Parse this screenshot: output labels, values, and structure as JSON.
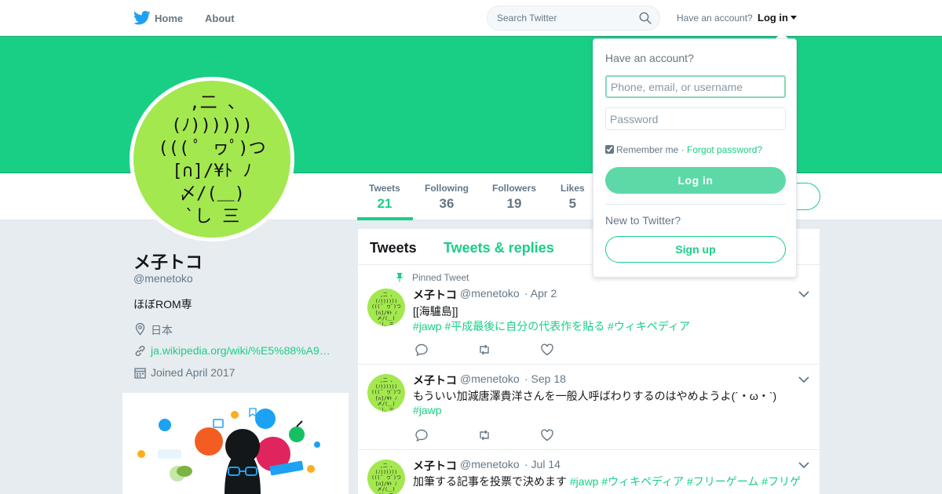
{
  "nav": {
    "home_label": "Home",
    "about_label": "About",
    "search_placeholder": "Search Twitter",
    "have_account": "Have an account?",
    "login_label": "Log in"
  },
  "profile": {
    "avatar_art": " ,二 、\n(ﾉ))))))\n((( ﾟ ヮﾟ)つ\n[∩]/¥ﾄ ﾉ\n〆/(＿)\n`し 三",
    "name": "メ子トコ",
    "handle": "@menetoko",
    "bio": "ほぼROM専",
    "location": "日本",
    "url": "ja.wikipedia.org/wiki/%E5%88%A9…",
    "joined": "Joined April 2017"
  },
  "stats": [
    {
      "label": "Tweets",
      "value": "21",
      "active": true
    },
    {
      "label": "Following",
      "value": "36",
      "active": false
    },
    {
      "label": "Followers",
      "value": "19",
      "active": false
    },
    {
      "label": "Likes",
      "value": "5",
      "active": false
    }
  ],
  "timeline": {
    "tabs": [
      {
        "label": "Tweets",
        "active": true
      },
      {
        "label": "Tweets & replies",
        "active": false
      }
    ],
    "pinned_label": "Pinned Tweet",
    "tweets": [
      {
        "name": "メ子トコ",
        "handle": "@menetoko",
        "date": "· Apr 2",
        "text": "[[海驢島]]",
        "tags": "#jawp #平成最後に自分の代表作を貼る #ウィキペディア"
      },
      {
        "name": "メ子トコ",
        "handle": "@menetoko",
        "date": "· Sep 18",
        "text": "もういい加減唐澤貴洋さんを一般人呼ばわりするのはやめようよ(´・ω・`)",
        "tags": "#jawp"
      },
      {
        "name": "メ子トコ",
        "handle": "@menetoko",
        "date": "· Jul 14",
        "text": "加筆する記事を投票で決めます",
        "tags": "#jawp #ウィキペディア #フリーゲーム #フリゲ"
      }
    ]
  },
  "login_dropdown": {
    "title": "Have an account?",
    "username_placeholder": "Phone, email, or username",
    "password_placeholder": "Password",
    "remember_me": "Remember me",
    "separator": " · ",
    "forgot_password": "Forgot password?",
    "login_button": "Log in",
    "new_to_twitter": "New to Twitter?",
    "signup_button": "Sign up"
  },
  "colors": {
    "brand": "#19cf86",
    "twitter_blue": "#1da1f2",
    "avatar_bg": "#a3e84f"
  }
}
